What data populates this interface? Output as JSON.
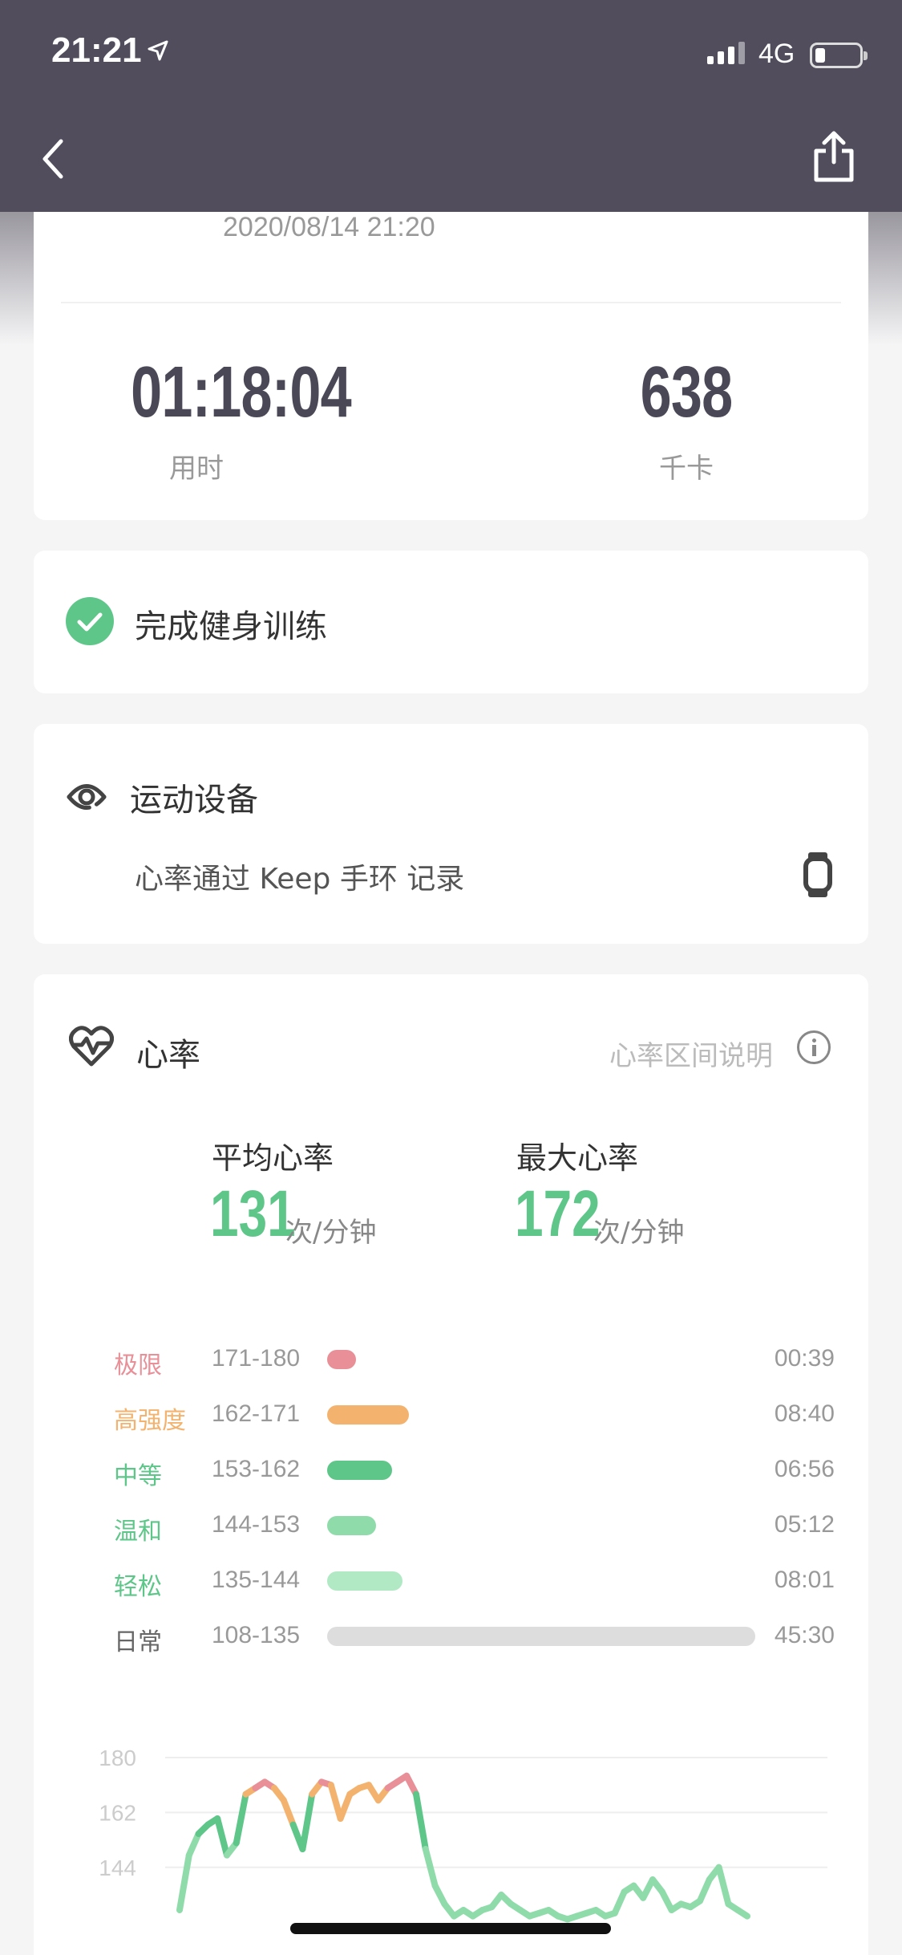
{
  "status_bar": {
    "time": "21:21",
    "network": "4G"
  },
  "workout": {
    "datetime": "2020/08/14 21:20",
    "duration": "01:18:04",
    "duration_label": "用时",
    "calories": "638",
    "calories_label": "千卡"
  },
  "completion": {
    "label": "完成健身训练"
  },
  "device": {
    "title": "运动设备",
    "subtitle": "心率通过 Keep 手环 记录"
  },
  "heart_rate": {
    "title": "心率",
    "help_link": "心率区间说明",
    "avg_label": "平均心率",
    "avg_value": "131",
    "max_label": "最大心率",
    "max_value": "172",
    "unit": "次/分钟",
    "zones": [
      {
        "name": "极限",
        "range": "171-180",
        "time": "00:39",
        "minutes": 0.65,
        "color": "#e88f97"
      },
      {
        "name": "高强度",
        "range": "162-171",
        "time": "08:40",
        "minutes": 8.67,
        "color": "#f3b36e"
      },
      {
        "name": "中等",
        "range": "153-162",
        "time": "06:56",
        "minutes": 6.93,
        "color": "#5ec689"
      },
      {
        "name": "温和",
        "range": "144-153",
        "time": "05:12",
        "minutes": 5.2,
        "color": "#8fdbaa"
      },
      {
        "name": "轻松",
        "range": "135-144",
        "time": "08:01",
        "minutes": 8.02,
        "color": "#b2e9c5"
      },
      {
        "name": "日常",
        "range": "108-135",
        "time": "45:30",
        "minutes": 45.5,
        "color": "#dddddd"
      }
    ],
    "zone_name_colors": [
      "#e88f97",
      "#f3b36e",
      "#5ec689",
      "#5ec689",
      "#5ec689",
      "#666666"
    ]
  },
  "chart_data": {
    "type": "line",
    "yticks": [
      180,
      162,
      144
    ],
    "ylim": [
      126,
      180
    ],
    "x": [
      0,
      1,
      2,
      3,
      4,
      5,
      6,
      7,
      8,
      9,
      10,
      11,
      12,
      13,
      14,
      15,
      16,
      17,
      18,
      19,
      20,
      21,
      22,
      23,
      24,
      25,
      26,
      27,
      28,
      29,
      30,
      31,
      32,
      33,
      34,
      35,
      36,
      37,
      38,
      39,
      40,
      41,
      42,
      43,
      44,
      45,
      46,
      47,
      48,
      49,
      50,
      51,
      52,
      53,
      54,
      55,
      56,
      57,
      58,
      59,
      60
    ],
    "values": [
      130,
      148,
      155,
      158,
      160,
      148,
      152,
      168,
      170,
      172,
      170,
      166,
      158,
      150,
      168,
      172,
      171,
      160,
      168,
      170,
      171,
      166,
      170,
      172,
      174,
      168,
      150,
      138,
      132,
      128,
      130,
      128,
      130,
      131,
      135,
      132,
      130,
      128,
      129,
      130,
      128,
      127,
      128,
      129,
      130,
      128,
      129,
      136,
      138,
      134,
      140,
      136,
      130,
      132,
      131,
      133,
      140,
      144,
      132,
      130,
      128
    ]
  },
  "colors": {
    "accent": "#5ec689",
    "topbar": "#514d5c"
  }
}
